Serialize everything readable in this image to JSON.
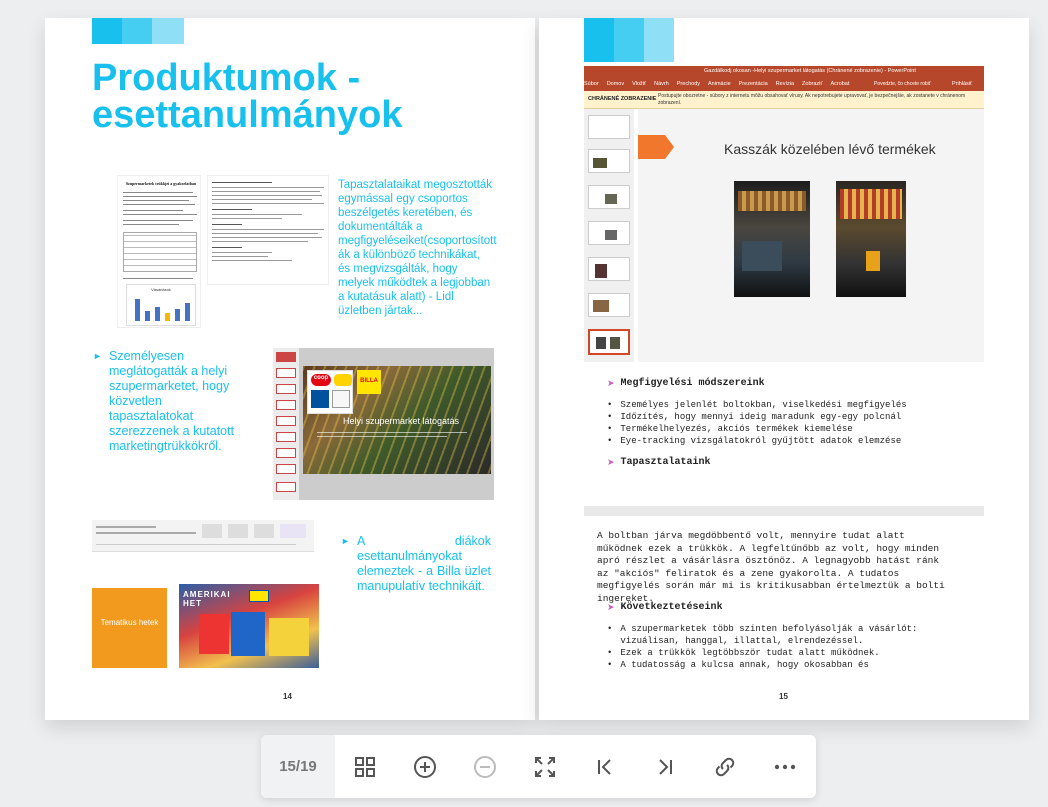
{
  "left_page": {
    "title": "Produktumok - esettanulmányok",
    "observation_text": "Tapasztalataikat megosztották egymással egy csoportos beszélgetés keretében, és dokumentálták a megfigyeléseiket(csoportosított ák a különböző technikákat, és megvizsgálták, hogy melyek működtek a legjobban a kutatásuk alatt) - Lidl üzletben jártak...",
    "bullet1": "Személyesen meglátogatták a helyi szupermarketet, hogy közvetlen tapasztalatokat szerezzenek a kutatott marketingtrükkökről.",
    "bullet2": "A diákok esettanulmányokat elemeztek - a Billa üzlet manupulatív technikáit.",
    "doc_thumb_title": "Szupermarketek trükkjei a gyakorlatban",
    "chart_thumb_title": "Vásárlások",
    "slide_title": "Helyi szupermarket látogatás",
    "coop_label": "coop",
    "billa_label": "BILLA",
    "orange_slide_label": "Tematikus hetek",
    "ad_label": "AMERIKAI HET",
    "page_number": "14"
  },
  "right_page": {
    "ppt_title": "Gazdálkodj okosan -Helyi szupermarket látogatás (Chránené zobrazenie) - PowerPoint",
    "ribbon_tabs": [
      "Súbor",
      "Domov",
      "Vložiť",
      "Návrh",
      "Prechody",
      "Animácie",
      "Prezentácia",
      "Revízia",
      "Zobraziť",
      "Acrobat"
    ],
    "tell_me": "Povedzte, čo chcete robiť",
    "sign_in": "Prihlásiť",
    "protected_label": "CHRÁNENÉ ZOBRAZENIE",
    "protected_text": "Postupujte obozretne - súbory z internetu môžu obsahovať vírusy. Ak nepotrebujete upravovať, je bezpečnejšie, ak zostanete v chránenom zobrazení.",
    "slide_heading": "Kasszák közelében lévő termékek",
    "methods_heading": "Megfigyelési módszereink",
    "methods": [
      "Személyes jelenlét boltokban, viselkedési megfigyelés",
      "Időzítés, hogy mennyi ideig maradunk egy-egy polcnál",
      "Termékelhelyezés, akciós termékek kiemelése",
      "Eye-tracking vizsgálatokról gyűjtött adatok elemzése"
    ],
    "experiences_heading": "Tapasztalataink",
    "experiences_text": "A boltban járva megdöbbentő volt, mennyire tudat alatt működnek ezek a trükkök. A legfeltűnőbb az volt, hogy minden apró részlet a vásárlásra ösztönöz. A legnagyobb hatást ránk az \"akciós\" feliratok és a zene gyakorolta. A tudatos megfigyelés során már mi is kritikusabban értelmeztük a bolti ingereket.",
    "conclusions_heading": "Következtetéseink",
    "conclusions": [
      "A szupermarketek több szinten befolyásolják a vásárlót: vizuálisan, hanggal, illattal, elrendezéssel.",
      "Ezek a trükkök legtöbbször tudat alatt működnek.",
      "A tudatosság a kulcsa annak, hogy okosabban és"
    ],
    "page_number": "15"
  },
  "toolbar": {
    "page_counter": "15/19"
  },
  "colors": {
    "accent": "#18c0ee",
    "accent_light": "#7fdcf6",
    "orange": "#f29a1e",
    "ppt_red": "#b7472a"
  }
}
